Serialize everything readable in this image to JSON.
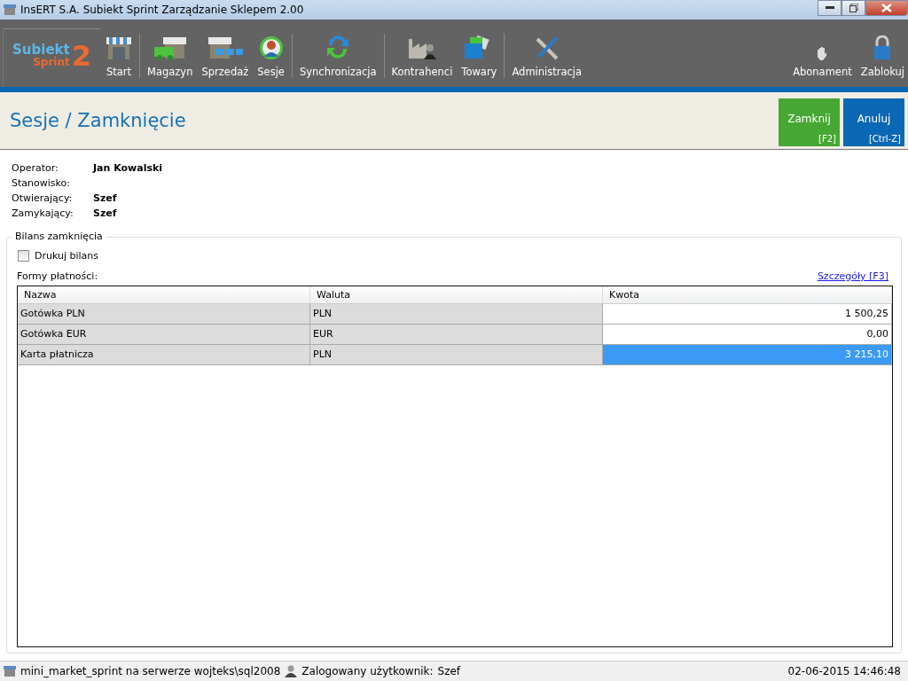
{
  "window": {
    "title": "InsERT S.A. Subiekt Sprint Zarządzanie Sklepem 2.00"
  },
  "logo": {
    "name": "Subiekt",
    "sub": "Sprint",
    "version": "2"
  },
  "toolbar_groups": [
    [
      {
        "label": "Start",
        "kind": "shop"
      }
    ],
    [
      {
        "label": "Magazyn",
        "kind": "truck"
      },
      {
        "label": "Sprzedaż",
        "kind": "carts"
      },
      {
        "label": "Sesje",
        "kind": "person"
      }
    ],
    [
      {
        "label": "Synchronizacja",
        "kind": "sync"
      }
    ],
    [
      {
        "label": "Kontrahenci",
        "kind": "factory"
      },
      {
        "label": "Towary",
        "kind": "boxes"
      }
    ],
    [
      {
        "label": "Administracja",
        "kind": "tools"
      }
    ]
  ],
  "toolbar_right": [
    {
      "label": "Abonament",
      "kind": "hand"
    },
    {
      "label": "Zablokuj",
      "kind": "lock"
    }
  ],
  "page_title": "Sesje / Zamknięcie",
  "actions": [
    {
      "label": "Zamknij",
      "shortcut": "[F2]",
      "kind": "confirm"
    },
    {
      "label": "Anuluj",
      "shortcut": "[Ctrl-Z]",
      "kind": "cancel"
    }
  ],
  "info": [
    {
      "label": "Operator:",
      "value": "Jan Kowalski"
    },
    {
      "label": "Stanowisko:"
    },
    {
      "label": "Otwierający:",
      "value": "Szef"
    },
    {
      "label": "Zamykający:",
      "value": "Szef"
    }
  ],
  "balance": {
    "legend": "Bilans zamknięcia",
    "print": {
      "label": "Drukuj bilans",
      "checked": false
    },
    "payments_label": "Formy płatności:",
    "details_link": "Szczegóły [F3]",
    "columns": [
      "Nazwa",
      "Waluta",
      "Kwota"
    ],
    "rows": [
      {
        "name": "Gotówka PLN",
        "currency": "PLN",
        "amount": "1 500,25",
        "selected": false
      },
      {
        "name": "Gotówka EUR",
        "currency": "EUR",
        "amount": "0,00",
        "selected": false
      },
      {
        "name": "Karta płatnicza",
        "currency": "PLN",
        "amount": "3 215,10",
        "selected": true
      }
    ]
  },
  "status_bar": {
    "database": "mini_market_sprint na serwerze wojteks\\sql2008",
    "user_label": "Zalogowany użytkownik:",
    "user": "Szef",
    "datetime": "02-06-2015 14:46:48"
  }
}
